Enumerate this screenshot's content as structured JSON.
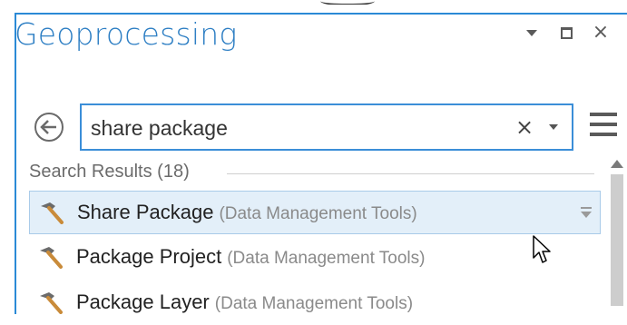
{
  "panel": {
    "title": "Geoprocessing",
    "window_controls": {
      "pin_icon": "chevron-down-icon",
      "max_icon": "maximize-icon",
      "close_glyph": "×"
    }
  },
  "search": {
    "value": "share package",
    "clear_glyph": "×",
    "back_icon": "back-arrow-icon",
    "dropdown_icon": "chevron-down-icon",
    "menu_icon": "hamburger-menu-icon"
  },
  "results": {
    "label": "Search Results (18)",
    "items": [
      {
        "name": "Share Package",
        "toolbox": "(Data Management Tools)",
        "selected": true,
        "icon": "hammer-icon"
      },
      {
        "name": "Package Project",
        "toolbox": "(Data Management Tools)",
        "selected": false,
        "icon": "hammer-icon"
      },
      {
        "name": "Package Layer",
        "toolbox": "(Data Management Tools)",
        "selected": false,
        "icon": "hammer-icon"
      }
    ]
  },
  "colors": {
    "accent": "#2e7fc4",
    "border": "#3b8ed8",
    "selected_bg": "#e3eff9"
  }
}
